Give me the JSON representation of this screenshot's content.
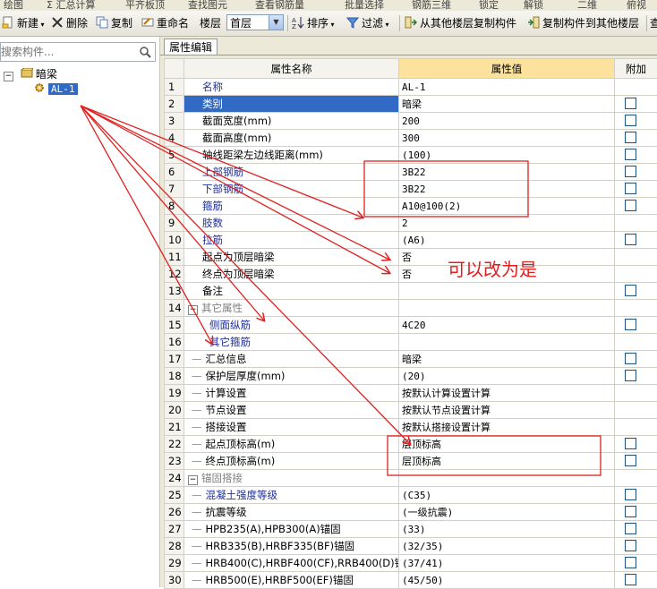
{
  "top_menu": [
    "绘图",
    "Σ 汇总计算",
    "平齐板顶",
    "查找图元",
    "查看钢筋量",
    "批量选择",
    "钢筋三维",
    "锁定",
    "解锁",
    "二维",
    "俯视"
  ],
  "toolbar": {
    "new_label": "新建",
    "delete_label": "删除",
    "copy_label": "复制",
    "rename_label": "重命名",
    "floor_label": "楼层",
    "floor_value": "首层",
    "sort_label": "排序",
    "filter_label": "过滤",
    "copy_from_label": "从其他楼层复制构件",
    "copy_to_label": "复制构件到其他楼层",
    "overflow_label": "查"
  },
  "left": {
    "search_placeholder": "搜索构件...",
    "tree_root": "暗梁",
    "tree_child": "AL-1"
  },
  "tab": {
    "label": "属性编辑"
  },
  "grid": {
    "headers": {
      "num": "",
      "name": "属性名称",
      "value": "属性值",
      "extra": "附加"
    },
    "rows": [
      {
        "n": "1",
        "name": "名称",
        "value": "AL-1",
        "color": "blue",
        "indent": 1,
        "cb": false
      },
      {
        "n": "2",
        "name": "类别",
        "value": "暗梁",
        "color": "blue",
        "indent": 1,
        "cb": true,
        "selected": true
      },
      {
        "n": "3",
        "name": "截面宽度(mm)",
        "value": "200",
        "color": "black",
        "indent": 1,
        "cb": true
      },
      {
        "n": "4",
        "name": "截面高度(mm)",
        "value": "300",
        "color": "black",
        "indent": 1,
        "cb": true
      },
      {
        "n": "5",
        "name": "轴线距梁左边线距离(mm)",
        "value": "(100)",
        "color": "black",
        "indent": 1,
        "cb": true
      },
      {
        "n": "6",
        "name": "上部钢筋",
        "value": "3B22",
        "color": "blue",
        "indent": 1,
        "cb": true
      },
      {
        "n": "7",
        "name": "下部钢筋",
        "value": "3B22",
        "color": "blue",
        "indent": 1,
        "cb": true
      },
      {
        "n": "8",
        "name": "箍筋",
        "value": "A10@100(2)",
        "color": "blue",
        "indent": 1,
        "cb": true
      },
      {
        "n": "9",
        "name": "肢数",
        "value": "2",
        "color": "blue",
        "indent": 1,
        "cb": false
      },
      {
        "n": "10",
        "name": "拉筋",
        "value": "(A6)",
        "color": "blue",
        "indent": 1,
        "cb": true
      },
      {
        "n": "11",
        "name": "起点为顶层暗梁",
        "value": "否",
        "color": "black",
        "indent": 1,
        "cb": false
      },
      {
        "n": "12",
        "name": "终点为顶层暗梁",
        "value": "否",
        "color": "black",
        "indent": 1,
        "cb": false
      },
      {
        "n": "13",
        "name": "备注",
        "value": "",
        "color": "black",
        "indent": 1,
        "cb": true
      },
      {
        "n": "14",
        "name": "其它属性",
        "value": "",
        "color": "grey",
        "group": true,
        "cb": false
      },
      {
        "n": "15",
        "name": "侧面纵筋",
        "value": "4C20",
        "color": "blue",
        "indent": 2,
        "cb": true
      },
      {
        "n": "16",
        "name": "其它箍筋",
        "value": "",
        "color": "blue",
        "indent": 2,
        "cb": false
      },
      {
        "n": "17",
        "name": "汇总信息",
        "value": "暗梁",
        "color": "black",
        "indent": 3,
        "cb": true
      },
      {
        "n": "18",
        "name": "保护层厚度(mm)",
        "value": "(20)",
        "color": "black",
        "indent": 3,
        "cb": true
      },
      {
        "n": "19",
        "name": "计算设置",
        "value": "按默认计算设置计算",
        "color": "black",
        "indent": 3,
        "cb": false
      },
      {
        "n": "20",
        "name": "节点设置",
        "value": "按默认节点设置计算",
        "color": "black",
        "indent": 3,
        "cb": false
      },
      {
        "n": "21",
        "name": "搭接设置",
        "value": "按默认搭接设置计算",
        "color": "black",
        "indent": 3,
        "cb": false
      },
      {
        "n": "22",
        "name": "起点顶标高(m)",
        "value": "层顶标高",
        "color": "black",
        "indent": 3,
        "cb": true
      },
      {
        "n": "23",
        "name": "终点顶标高(m)",
        "value": "层顶标高",
        "color": "black",
        "indent": 3,
        "cb": true
      },
      {
        "n": "24",
        "name": "锚固搭接",
        "value": "",
        "color": "grey",
        "group": true,
        "cb": false
      },
      {
        "n": "25",
        "name": "混凝土强度等级",
        "value": "(C35)",
        "color": "blue",
        "indent": 3,
        "cb": true
      },
      {
        "n": "26",
        "name": "抗震等级",
        "value": "(一级抗震)",
        "color": "black",
        "indent": 3,
        "cb": true
      },
      {
        "n": "27",
        "name": "HPB235(A),HPB300(A)锚固",
        "value": "(33)",
        "color": "black",
        "indent": 3,
        "cb": true
      },
      {
        "n": "28",
        "name": "HRB335(B),HRBF335(BF)锚固",
        "value": "(32/35)",
        "color": "black",
        "indent": 3,
        "cb": true
      },
      {
        "n": "29",
        "name": "HRB400(C),HRBF400(CF),RRB400(D)锚",
        "value": "(37/41)",
        "color": "black",
        "indent": 3,
        "cb": true
      },
      {
        "n": "30",
        "name": "HRB500(E),HRBF500(EF)锚固",
        "value": "(45/50)",
        "color": "black",
        "indent": 3,
        "cb": true
      }
    ]
  },
  "annotation": {
    "note_text": "可以改为是",
    "color": "#e02020"
  }
}
